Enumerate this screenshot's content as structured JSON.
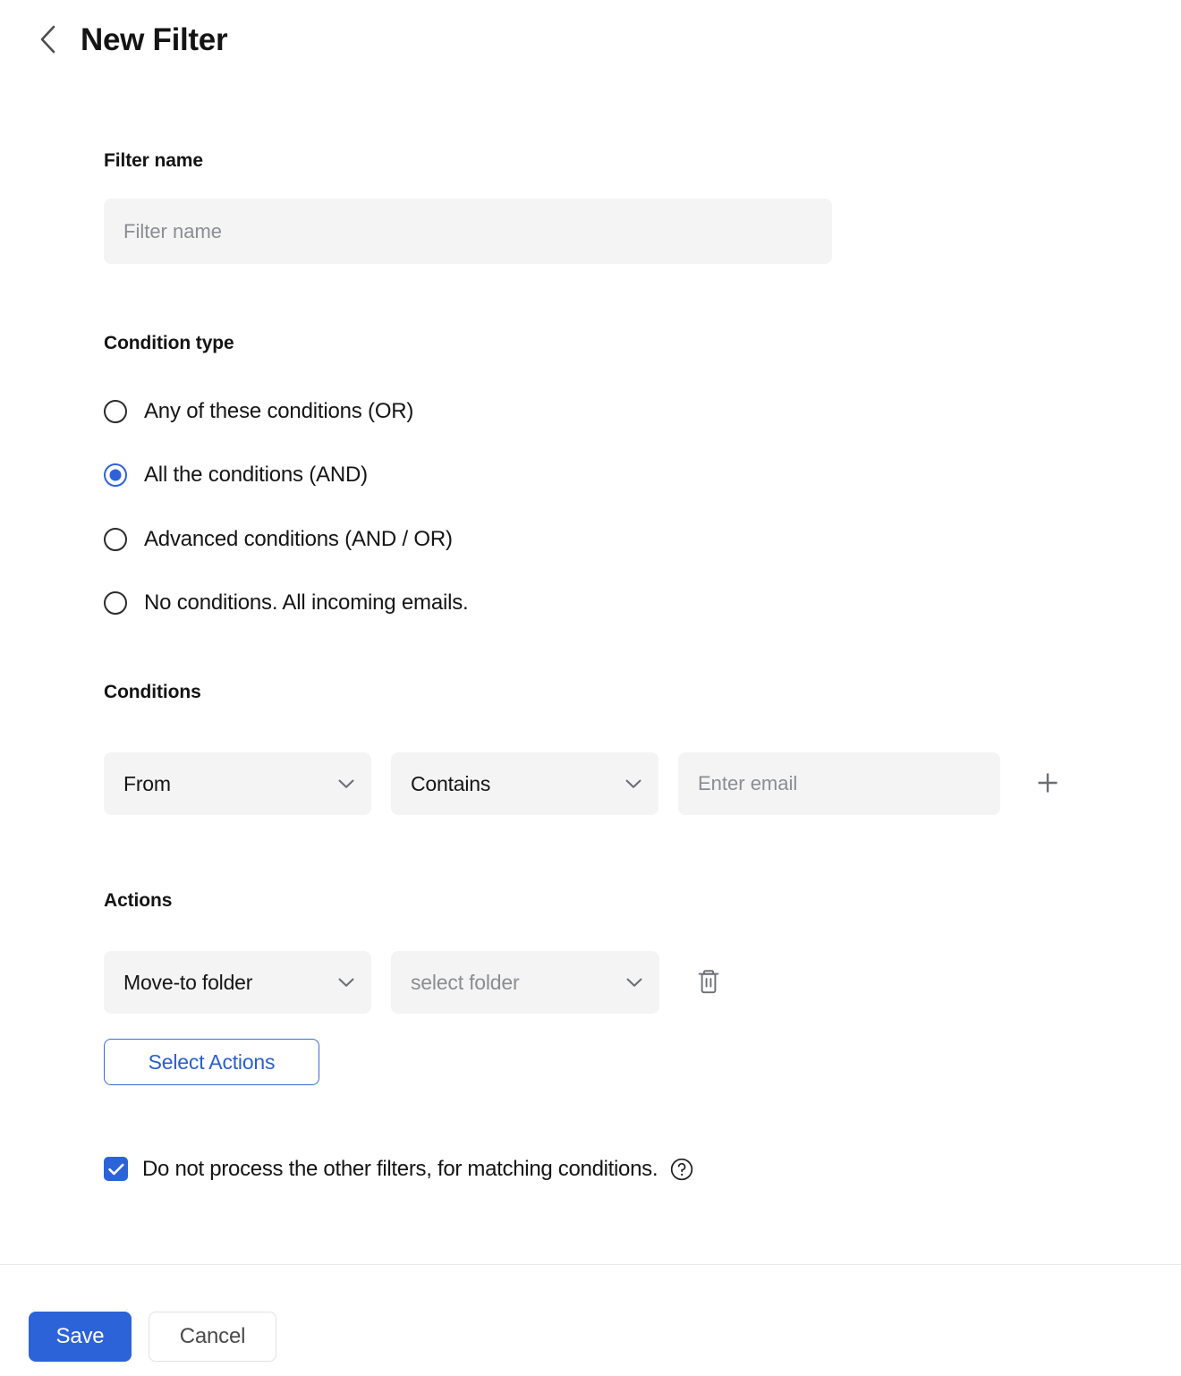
{
  "header": {
    "back_icon": "chevron-left-icon",
    "title": "New Filter"
  },
  "filter_name": {
    "label": "Filter name",
    "placeholder": "Filter name",
    "value": ""
  },
  "condition_type": {
    "label": "Condition type",
    "options": [
      {
        "label": "Any of these conditions (OR)",
        "selected": false
      },
      {
        "label": "All the conditions (AND)",
        "selected": true
      },
      {
        "label": "Advanced conditions (AND / OR)",
        "selected": false
      },
      {
        "label": "No conditions. All incoming emails.",
        "selected": false
      }
    ]
  },
  "conditions": {
    "label": "Conditions",
    "rows": [
      {
        "field": "From",
        "operator": "Contains",
        "value_placeholder": "Enter email",
        "value": ""
      }
    ],
    "add_icon": "plus-icon"
  },
  "actions": {
    "label": "Actions",
    "rows": [
      {
        "type": "Move-to folder",
        "target_placeholder": "select folder",
        "target": ""
      }
    ],
    "delete_icon": "trash-icon",
    "select_actions_label": "Select Actions"
  },
  "stop_processing": {
    "label": "Do not process the other filters, for matching conditions.",
    "checked": true,
    "help_icon": "question-circle-icon"
  },
  "footer": {
    "save_label": "Save",
    "cancel_label": "Cancel"
  },
  "colors": {
    "accent_blue": "#2d63d8",
    "field_bg": "#f4f4f5",
    "placeholder": "#8a8d91",
    "divider": "#e8e8e8",
    "text": "#151515"
  }
}
